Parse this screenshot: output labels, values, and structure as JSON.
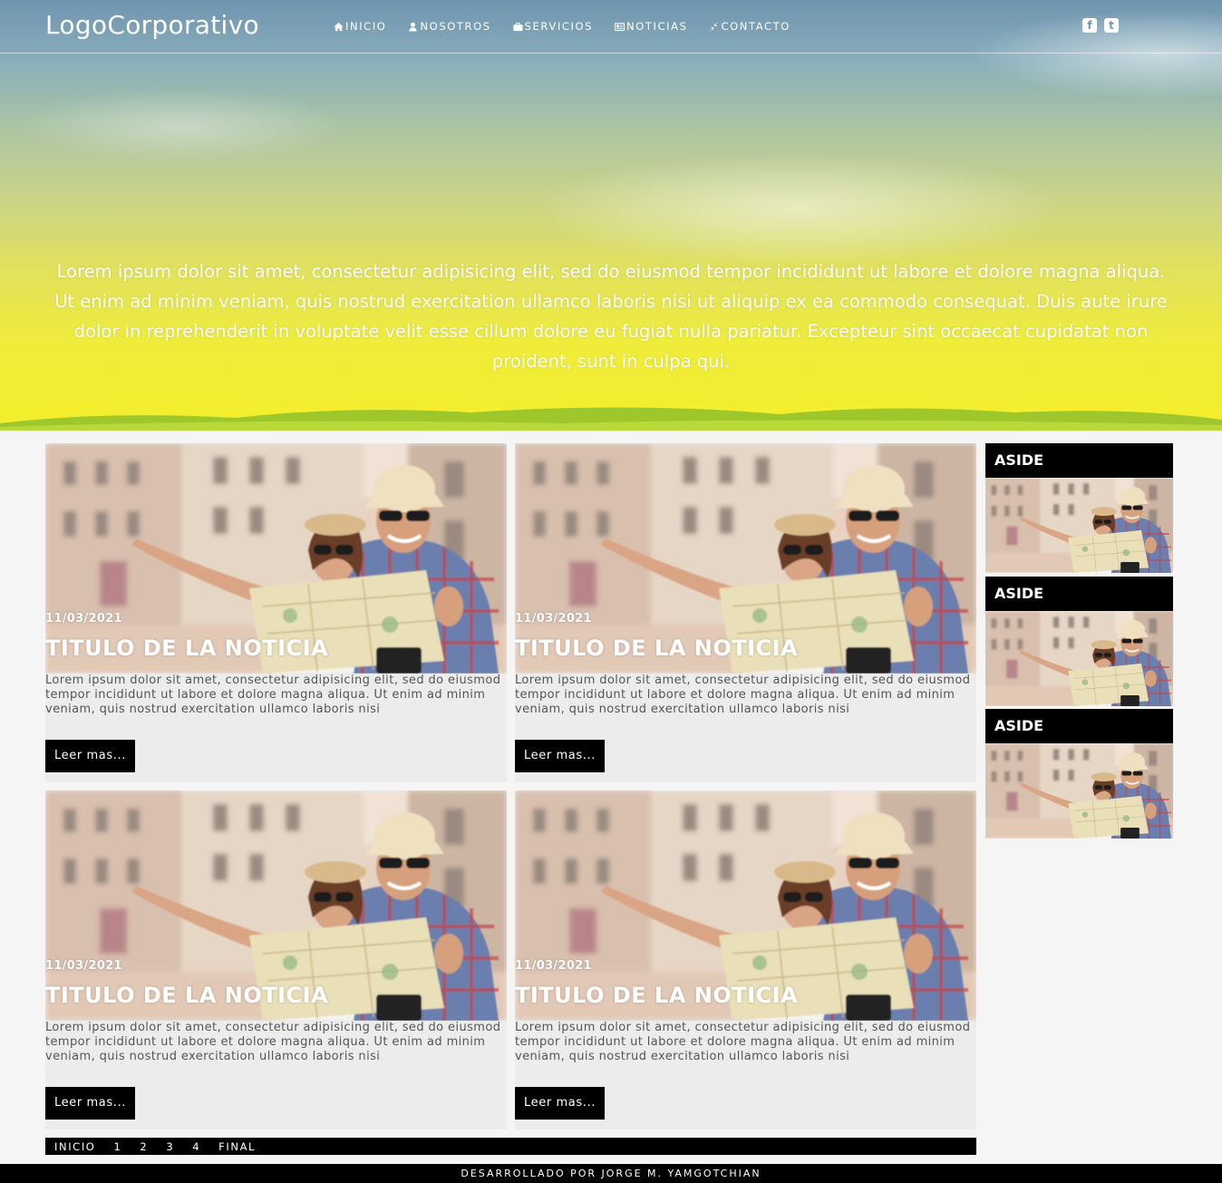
{
  "header": {
    "logo": "LogoCorporativo",
    "menu": [
      {
        "label": "INICIO",
        "icon": "home-icon"
      },
      {
        "label": "NOSOTROS",
        "icon": "user-icon"
      },
      {
        "label": "SERVICIOS",
        "icon": "briefcase-icon"
      },
      {
        "label": "NOTICIAS",
        "icon": "newspaper-icon"
      },
      {
        "label": "CONTACTO",
        "icon": "compress-icon"
      }
    ],
    "social": [
      {
        "label": "f",
        "icon": "facebook-icon"
      },
      {
        "label": "t",
        "icon": "twitter-icon"
      }
    ]
  },
  "hero": {
    "text": "Lorem ipsum dolor sit amet, consectetur adipisicing elit, sed do eiusmod tempor incididunt ut labore et dolore magna aliqua. Ut enim ad minim veniam, quis nostrud exercitation ullamco laboris nisi ut aliquip ex ea commodo consequat. Duis aute irure dolor in reprehenderit in voluptate velit esse cillum dolore eu fugiat nulla pariatur. Excepteur sint occaecat cupidatat non proident, sunt in culpa qui."
  },
  "news": [
    {
      "date": "11/03/2021",
      "title": "TITULO DE LA NOTICIA",
      "text": "Lorem ipsum dolor sit amet, consectetur adipisicing elit, sed do eiusmod tempor incididunt ut labore et dolore magna aliqua. Ut enim ad minim veniam, quis nostrud exercitation ullamco laboris nisi",
      "button": "Leer mas..."
    },
    {
      "date": "11/03/2021",
      "title": "TITULO DE LA NOTICIA",
      "text": "Lorem ipsum dolor sit amet, consectetur adipisicing elit, sed do eiusmod tempor incididunt ut labore et dolore magna aliqua. Ut enim ad minim veniam, quis nostrud exercitation ullamco laboris nisi",
      "button": "Leer mas..."
    },
    {
      "date": "11/03/2021",
      "title": "TITULO DE LA NOTICIA",
      "text": "Lorem ipsum dolor sit amet, consectetur adipisicing elit, sed do eiusmod tempor incididunt ut labore et dolore magna aliqua. Ut enim ad minim veniam, quis nostrud exercitation ullamco laboris nisi",
      "button": "Leer mas..."
    },
    {
      "date": "11/03/2021",
      "title": "TITULO DE LA NOTICIA",
      "text": "Lorem ipsum dolor sit amet, consectetur adipisicing elit, sed do eiusmod tempor incididunt ut labore et dolore magna aliqua. Ut enim ad minim veniam, quis nostrud exercitation ullamco laboris nisi",
      "button": "Leer mas..."
    }
  ],
  "aside": [
    {
      "title": "ASIDE"
    },
    {
      "title": "ASIDE"
    },
    {
      "title": "ASIDE"
    }
  ],
  "pagination": [
    "INICIO",
    "1",
    "2",
    "3",
    "4",
    "FINAL"
  ],
  "footer": {
    "credit": "DESARROLLADO POR JORGE M. YAMGOTCHIAN"
  },
  "colors": {
    "sky_top": "#6f94b0",
    "sky_bottom": "#f4ee2a",
    "bar": "#000000",
    "card_bg": "#ececec"
  }
}
